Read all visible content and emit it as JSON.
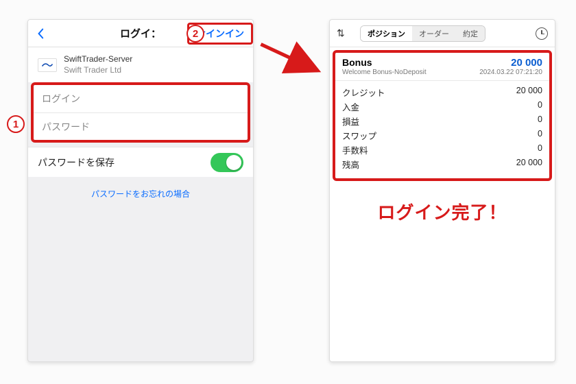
{
  "annotations": {
    "step1": "1",
    "step2": "2",
    "completed": "ログイン完了！"
  },
  "left": {
    "header_title": "ログイ：",
    "signin": "サインイン",
    "server_name": "SwiftTrader-Server",
    "server_company": "Swift Trader Ltd",
    "login_placeholder": "ログイン",
    "password_placeholder": "パスワード",
    "save_password": "パスワードを保存",
    "forgot": "パスワードをお忘れの場合"
  },
  "right": {
    "tabs": {
      "positions": "ポジション",
      "orders": "オーダー",
      "deals": "約定"
    },
    "account": {
      "name": "Bonus",
      "balance": "20 000",
      "desc": "Welcome Bonus-NoDeposit",
      "timestamp": "2024.03.22 07:21:20"
    },
    "rows": {
      "credit_l": "クレジット",
      "credit_v": "20 000",
      "deposit_l": "入金",
      "deposit_v": "0",
      "pl_l": "損益",
      "pl_v": "0",
      "swap_l": "スワップ",
      "swap_v": "0",
      "comm_l": "手数料",
      "comm_v": "0",
      "equity_l": "残高",
      "equity_v": "20 000"
    }
  }
}
